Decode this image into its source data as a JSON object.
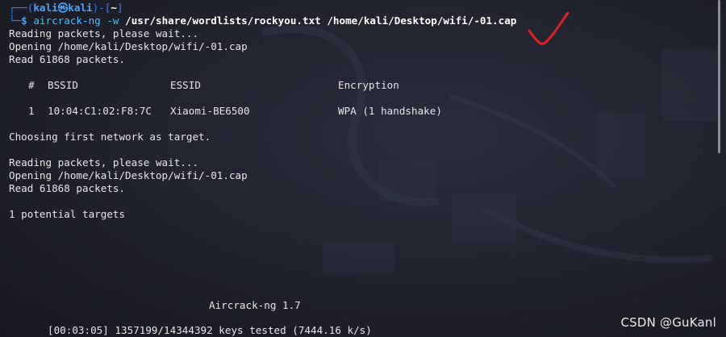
{
  "prompt": {
    "frame_top_left": "┌──(",
    "user": "kali",
    "at_symbol": "㉿",
    "host": "kali",
    "frame_mid": ")-[",
    "cwd": "~",
    "frame_end": "]",
    "frame_bottom": "└─",
    "dollar": "$ "
  },
  "command": {
    "name": "aircrack-ng",
    "flag": "-w",
    "wordlist": "/usr/share/wordlists/rockyou.txt",
    "capfile": "/home/kali/Desktop/wifi/-01.cap"
  },
  "output": {
    "reading_1": "Reading packets, please wait...",
    "opening_1": "Opening /home/kali/Desktop/wifi/-01.cap",
    "read_1": "Read 61868 packets.",
    "table_header": {
      "num": "#",
      "bssid": "BSSID",
      "essid": "ESSID",
      "encryption": "Encryption"
    },
    "table_row": {
      "num": "1",
      "bssid": "10:04:C1:02:F8:7C",
      "essid": "Xiaomi-BE6500",
      "encryption": "WPA (1 handshake)"
    },
    "choosing": "Choosing first network as target.",
    "reading_2": "Reading packets, please wait...",
    "opening_2": "Opening /home/kali/Desktop/wifi/-01.cap",
    "read_2": "Read 61868 packets.",
    "targets": "1 potential targets",
    "version": "Aircrack-ng 1.7",
    "progress": "[00:03:05] 1357199/14344392 keys tested (7444.16 k/s)"
  },
  "watermark": "CSDN @GuKanl",
  "colors": {
    "background": "#1d1f29",
    "prompt_blue": "#2a7fff",
    "command_cyan": "#3fc1ff",
    "annotation_red": "#e02020"
  }
}
